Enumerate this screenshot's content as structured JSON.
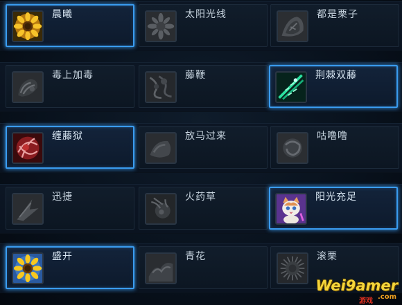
{
  "colors": {
    "selected_border": "#3a9cf0",
    "label_text": "#d8e6f2",
    "background": "#08111c"
  },
  "talents": [
    {
      "id": "t1",
      "name": "晨曦",
      "icon": "sunflower-icon",
      "state": "selected"
    },
    {
      "id": "t2",
      "name": "太阳光线",
      "icon": "sun-ray-flower-icon",
      "state": "locked"
    },
    {
      "id": "t3",
      "name": "都是栗子",
      "icon": "chestnut-shell-icon",
      "state": "locked"
    },
    {
      "id": "t4",
      "name": "毒上加毒",
      "icon": "poison-vine-icon",
      "state": "locked"
    },
    {
      "id": "t5",
      "name": "藤鞭",
      "icon": "vine-whip-icon",
      "state": "locked"
    },
    {
      "id": "t6",
      "name": "荆棘双藤",
      "icon": "thorn-vines-icon",
      "state": "selected"
    },
    {
      "id": "t7",
      "name": "缠藤狱",
      "icon": "entangle-icon",
      "state": "selected"
    },
    {
      "id": "t8",
      "name": "放马过来",
      "icon": "charge-icon",
      "state": "locked"
    },
    {
      "id": "t9",
      "name": "咕噜噜",
      "icon": "rolling-icon",
      "state": "locked"
    },
    {
      "id": "t10",
      "name": "迅捷",
      "icon": "swift-icon",
      "state": "locked"
    },
    {
      "id": "t11",
      "name": "火药草",
      "icon": "gunpowder-weed-icon",
      "state": "locked"
    },
    {
      "id": "t12",
      "name": "阳光充足",
      "icon": "cat-pet-icon",
      "state": "selected"
    },
    {
      "id": "t13",
      "name": "盛开",
      "icon": "blooming-flower-icon",
      "state": "selected"
    },
    {
      "id": "t14",
      "name": "青花",
      "icon": "green-flower-icon",
      "state": "locked"
    },
    {
      "id": "t15",
      "name": "滚栗",
      "icon": "spiky-chestnut-icon",
      "state": "locked"
    }
  ],
  "watermark": {
    "main": "Wei9amer",
    "sub": ".com",
    "cn": "游戏"
  }
}
